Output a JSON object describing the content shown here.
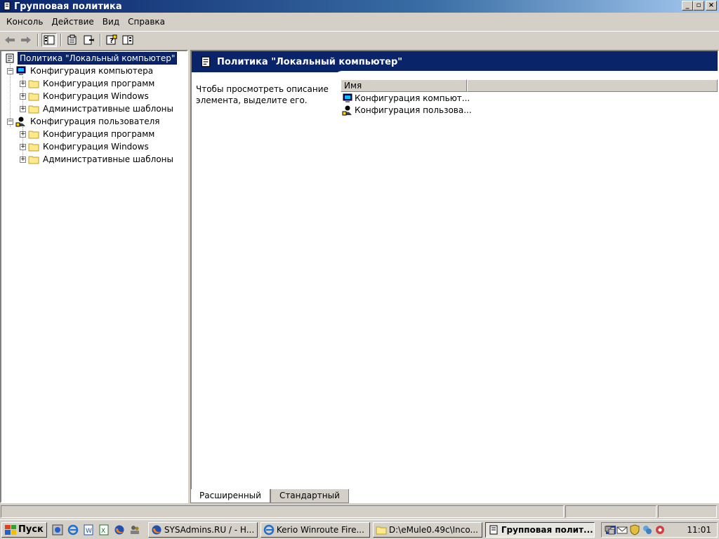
{
  "window": {
    "title": "Групповая политика",
    "icon": "scroll-icon",
    "controls": [
      "_",
      "▫",
      "×"
    ]
  },
  "menubar": {
    "items": [
      "Консоль",
      "Действие",
      "Вид",
      "Справка"
    ]
  },
  "toolbar": {
    "buttons": [
      "back-icon",
      "forward-icon",
      "show-hide-tree-icon",
      "properties-icon",
      "export-list-icon",
      "help-icon",
      "view-icon"
    ]
  },
  "tree": {
    "root": "Политика \"Локальный компьютер\"",
    "computer_config": "Конфигурация компьютера",
    "user_config": "Конфигурация пользователя",
    "software_settings": "Конфигурация программ",
    "windows_settings": "Конфигурация Windows",
    "admin_templates": "Административные шаблоны"
  },
  "details": {
    "header_title": "Политика \"Локальный компьютер\"",
    "description": "Чтобы просмотреть описание элемента, выделите его.",
    "column_name": "Имя",
    "rows": [
      "Конфигурация компьют...",
      "Конфигурация пользова..."
    ]
  },
  "tabs": [
    "Расширенный",
    "Стандартный"
  ],
  "taskbar": {
    "start_label": "Пуск",
    "tasks": [
      "SYSAdmins.RU / - H...",
      "Kerio Winroute Fire...",
      "D:\\eMule0.49c\\Inco...",
      "Групповая полит..."
    ],
    "clock": "11:01"
  },
  "colors": {
    "header_band": "#0a246a",
    "title_gradient_start": "#0a246a",
    "title_gradient_end": "#a6caf0"
  }
}
